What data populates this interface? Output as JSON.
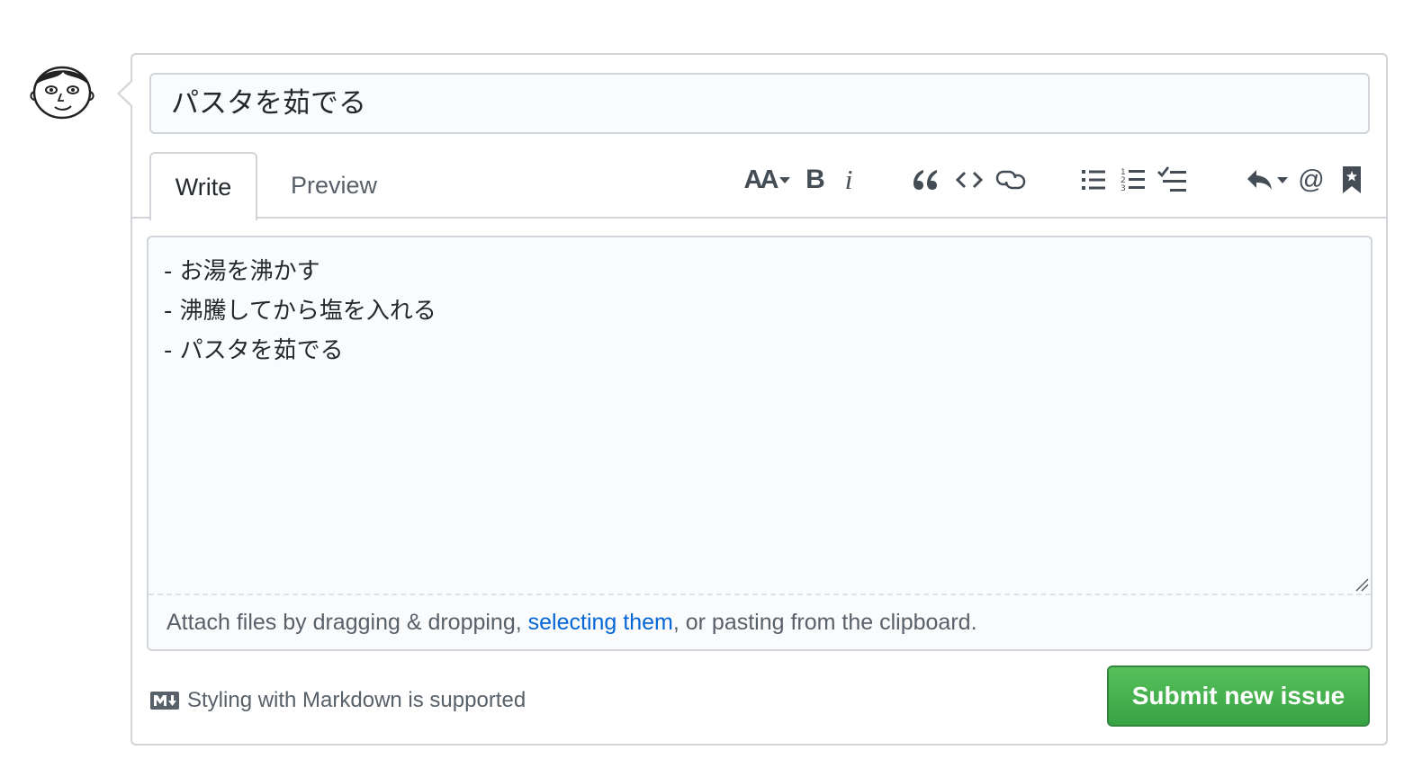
{
  "issue": {
    "title": "パスタを茹でる",
    "body": "- お湯を沸かす\n- 沸騰してから塩を入れる\n- パスタを茹でる"
  },
  "tabs": {
    "write": "Write",
    "preview": "Preview"
  },
  "toolbar": {
    "icons": [
      "text-size-icon",
      "bold-icon",
      "italic-icon",
      "quote-icon",
      "code-icon",
      "link-icon",
      "bulleted-list-icon",
      "numbered-list-icon",
      "task-list-icon",
      "reply-icon",
      "mention-icon",
      "bookmark-icon"
    ],
    "bold_glyph": "B",
    "italic_glyph": "i",
    "mention_glyph": "@",
    "text_size_glyph": "AA"
  },
  "attach": {
    "prefix": "Attach files by dragging & dropping, ",
    "link": "selecting them",
    "suffix": ", or pasting from the clipboard."
  },
  "markdown_note": "Styling with Markdown is supported",
  "submit_label": "Submit new issue",
  "colors": {
    "accent_green": "#2ea44f",
    "link_blue": "#0366d6",
    "border": "#d1d5da"
  }
}
